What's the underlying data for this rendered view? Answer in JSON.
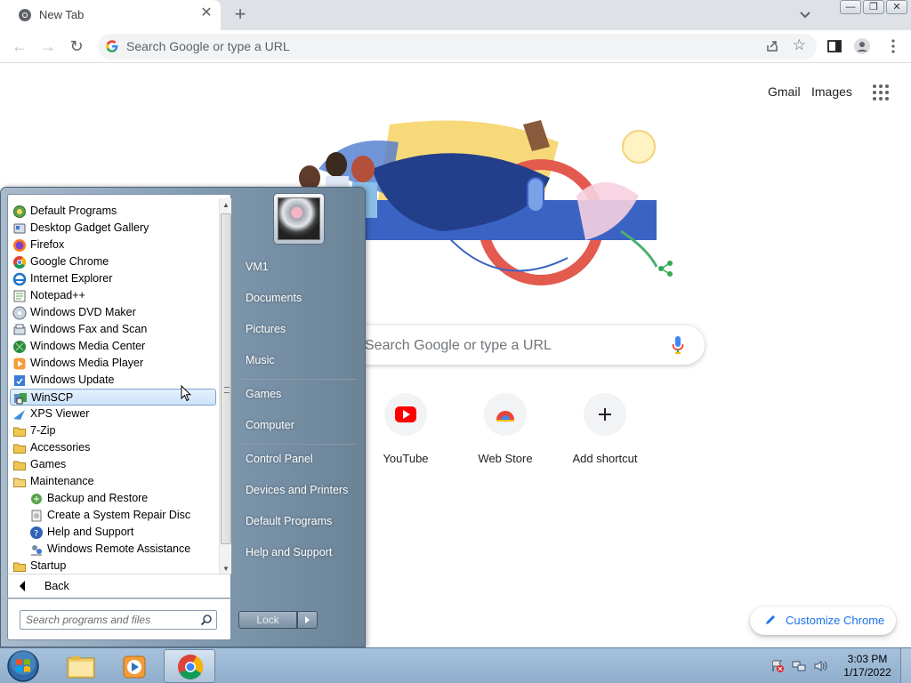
{
  "browser": {
    "tab": {
      "title": "New Tab",
      "close": "✕"
    },
    "new_tab": "+",
    "omnibox": {
      "placeholder": "Search Google or type a URL"
    }
  },
  "window_buttons": {
    "minimize": "—",
    "restore": "❐",
    "close": "✕"
  },
  "ntp": {
    "gmail": "Gmail",
    "images": "Images",
    "search_placeholder": "Search Google or type a URL",
    "shortcuts": [
      {
        "label": "YouTube",
        "icon": "youtube-icon"
      },
      {
        "label": "Web Store",
        "icon": "web-store-icon"
      },
      {
        "label": "Add shortcut",
        "icon": "plus-icon"
      }
    ],
    "customize": "Customize Chrome"
  },
  "start_menu": {
    "programs": [
      {
        "label": "Default Programs",
        "icon": "default-programs-icon",
        "indent": 0,
        "selected": false
      },
      {
        "label": "Desktop Gadget Gallery",
        "icon": "gadget-icon",
        "indent": 0,
        "selected": false
      },
      {
        "label": "Firefox",
        "icon": "firefox-icon",
        "indent": 0,
        "selected": false
      },
      {
        "label": "Google Chrome",
        "icon": "chrome-icon",
        "indent": 0,
        "selected": false
      },
      {
        "label": "Internet Explorer",
        "icon": "ie-icon",
        "indent": 0,
        "selected": false
      },
      {
        "label": "Notepad++",
        "icon": "notepadpp-icon",
        "indent": 0,
        "selected": false
      },
      {
        "label": "Windows DVD Maker",
        "icon": "dvd-maker-icon",
        "indent": 0,
        "selected": false
      },
      {
        "label": "Windows Fax and Scan",
        "icon": "fax-icon",
        "indent": 0,
        "selected": false
      },
      {
        "label": "Windows Media Center",
        "icon": "media-center-icon",
        "indent": 0,
        "selected": false
      },
      {
        "label": "Windows Media Player",
        "icon": "media-player-icon",
        "indent": 0,
        "selected": false
      },
      {
        "label": "Windows Update",
        "icon": "windows-update-icon",
        "indent": 0,
        "selected": false
      },
      {
        "label": "WinSCP",
        "icon": "winscp-icon",
        "indent": 0,
        "selected": true
      },
      {
        "label": "XPS Viewer",
        "icon": "xps-viewer-icon",
        "indent": 0,
        "selected": false
      },
      {
        "label": "7-Zip",
        "icon": "folder-icon",
        "indent": 0,
        "selected": false
      },
      {
        "label": "Accessories",
        "icon": "folder-icon",
        "indent": 0,
        "selected": false
      },
      {
        "label": "Games",
        "icon": "folder-icon",
        "indent": 0,
        "selected": false
      },
      {
        "label": "Maintenance",
        "icon": "folder-open-icon",
        "indent": 0,
        "selected": false
      },
      {
        "label": "Backup and Restore",
        "icon": "backup-icon",
        "indent": 1,
        "selected": false
      },
      {
        "label": "Create a System Repair Disc",
        "icon": "repair-disc-icon",
        "indent": 1,
        "selected": false
      },
      {
        "label": "Help and Support",
        "icon": "help-icon",
        "indent": 1,
        "selected": false
      },
      {
        "label": "Windows Remote Assistance",
        "icon": "remote-assistance-icon",
        "indent": 1,
        "selected": false
      },
      {
        "label": "Startup",
        "icon": "folder-icon",
        "indent": 0,
        "selected": false
      }
    ],
    "back": "Back",
    "search_placeholder": "Search programs and files",
    "right_items": [
      "VM1",
      "Documents",
      "Pictures",
      "Music",
      "Games",
      "Computer",
      "Control Panel",
      "Devices and Printers",
      "Default Programs",
      "Help and Support"
    ],
    "lock": "Lock"
  },
  "taskbar": {
    "time": "3:03 PM",
    "date": "1/17/2022"
  }
}
